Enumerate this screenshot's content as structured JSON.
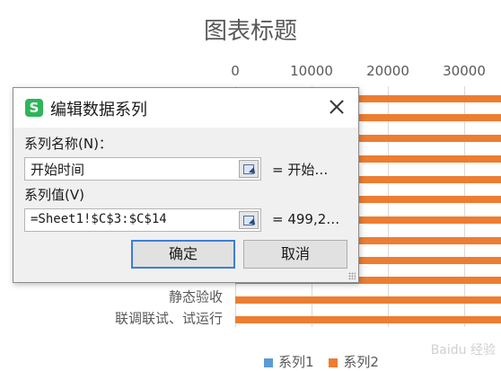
{
  "chart_data": {
    "type": "bar",
    "title": "图表标题",
    "orientation": "horizontal",
    "x_ticks": [
      "0",
      "10000",
      "20000",
      "30000"
    ],
    "xlim": [
      0,
      35000
    ],
    "visible_categories": [
      "静态验收",
      "联调联试、试运行"
    ],
    "partial_category": "",
    "series": [
      {
        "name": "系列1",
        "color": "#5b9bd5"
      },
      {
        "name": "系列2",
        "color": "#ed7d31"
      }
    ],
    "legend_position": "bottom"
  },
  "dialog": {
    "title": "编辑数据系列",
    "app_icon_glyph": "S",
    "name_label": "系列名称(N)：",
    "name_value": "开始时间",
    "name_preview": "= 开始…",
    "values_label": "系列值(V)",
    "values_value": "=Sheet1!$C$3:$C$14",
    "values_preview": "= 499,2…",
    "ok_label": "确定",
    "cancel_label": "取消"
  },
  "watermark": "Baidu 经验"
}
